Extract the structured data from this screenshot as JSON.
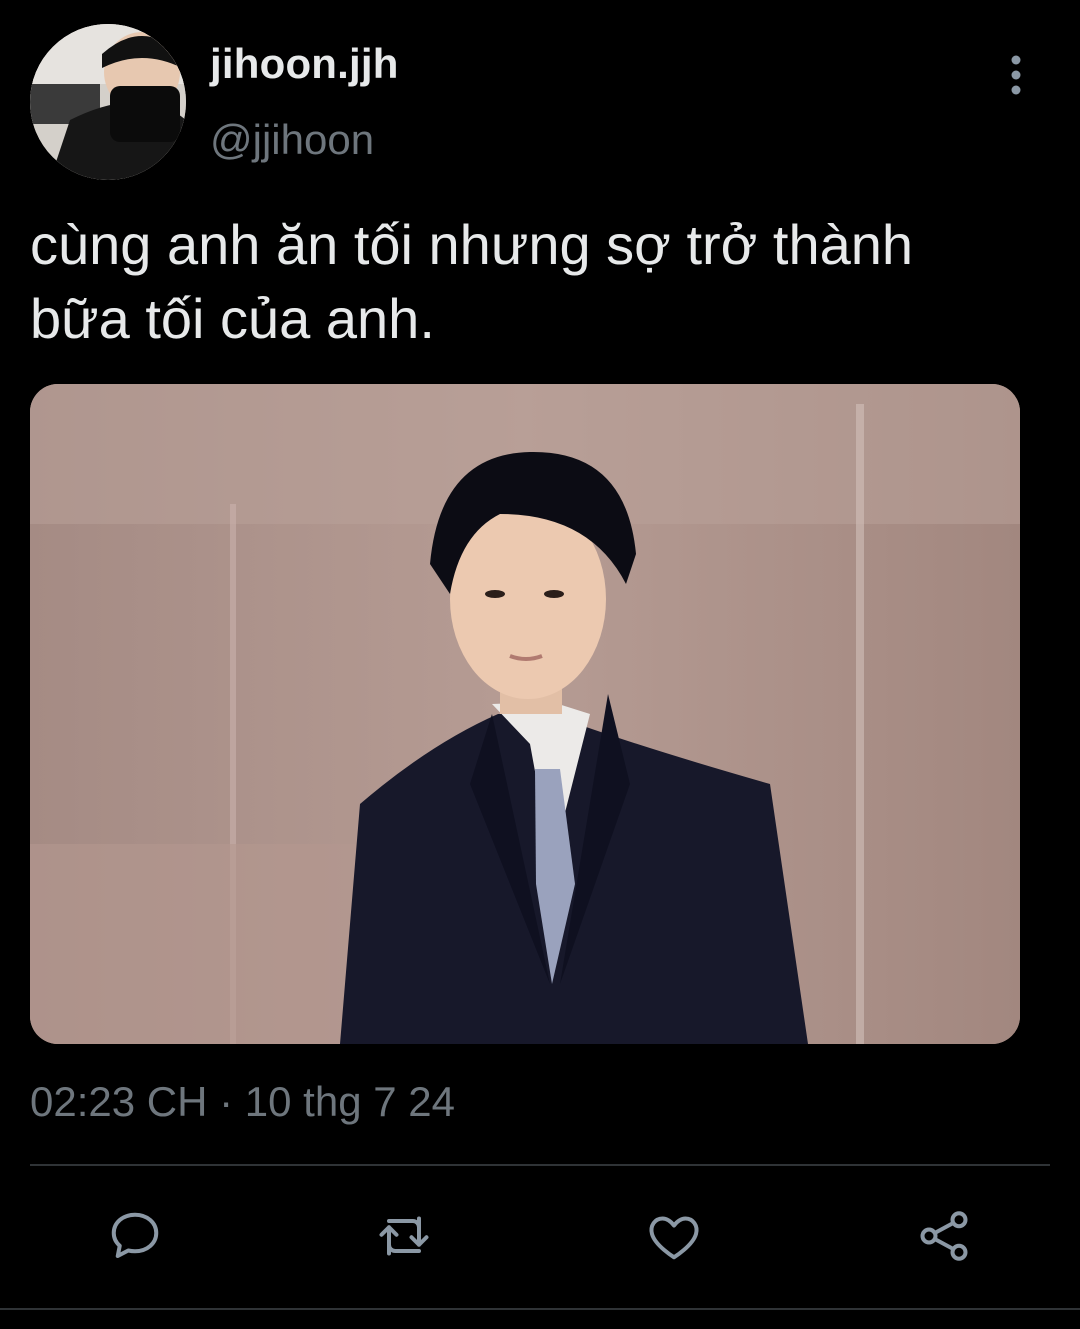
{
  "tweet": {
    "author": {
      "display_name": "jihoon.jjh",
      "handle": "@jjihoon"
    },
    "text": "cùng anh ăn tối nhưng sợ trở thành\nbữa tối của anh.",
    "time": "02:23 CH",
    "separator": "·",
    "date": "10 thg 7 24"
  },
  "icons": {
    "more": "more-vertical-icon",
    "reply": "reply-icon",
    "retweet": "retweet-icon",
    "like": "heart-icon",
    "share": "share-icon"
  },
  "colors": {
    "background": "#000000",
    "primary_text": "#e7e9ea",
    "secondary_text": "#6e767d",
    "icon": "#8b98a5",
    "divider": "#2f3336"
  }
}
